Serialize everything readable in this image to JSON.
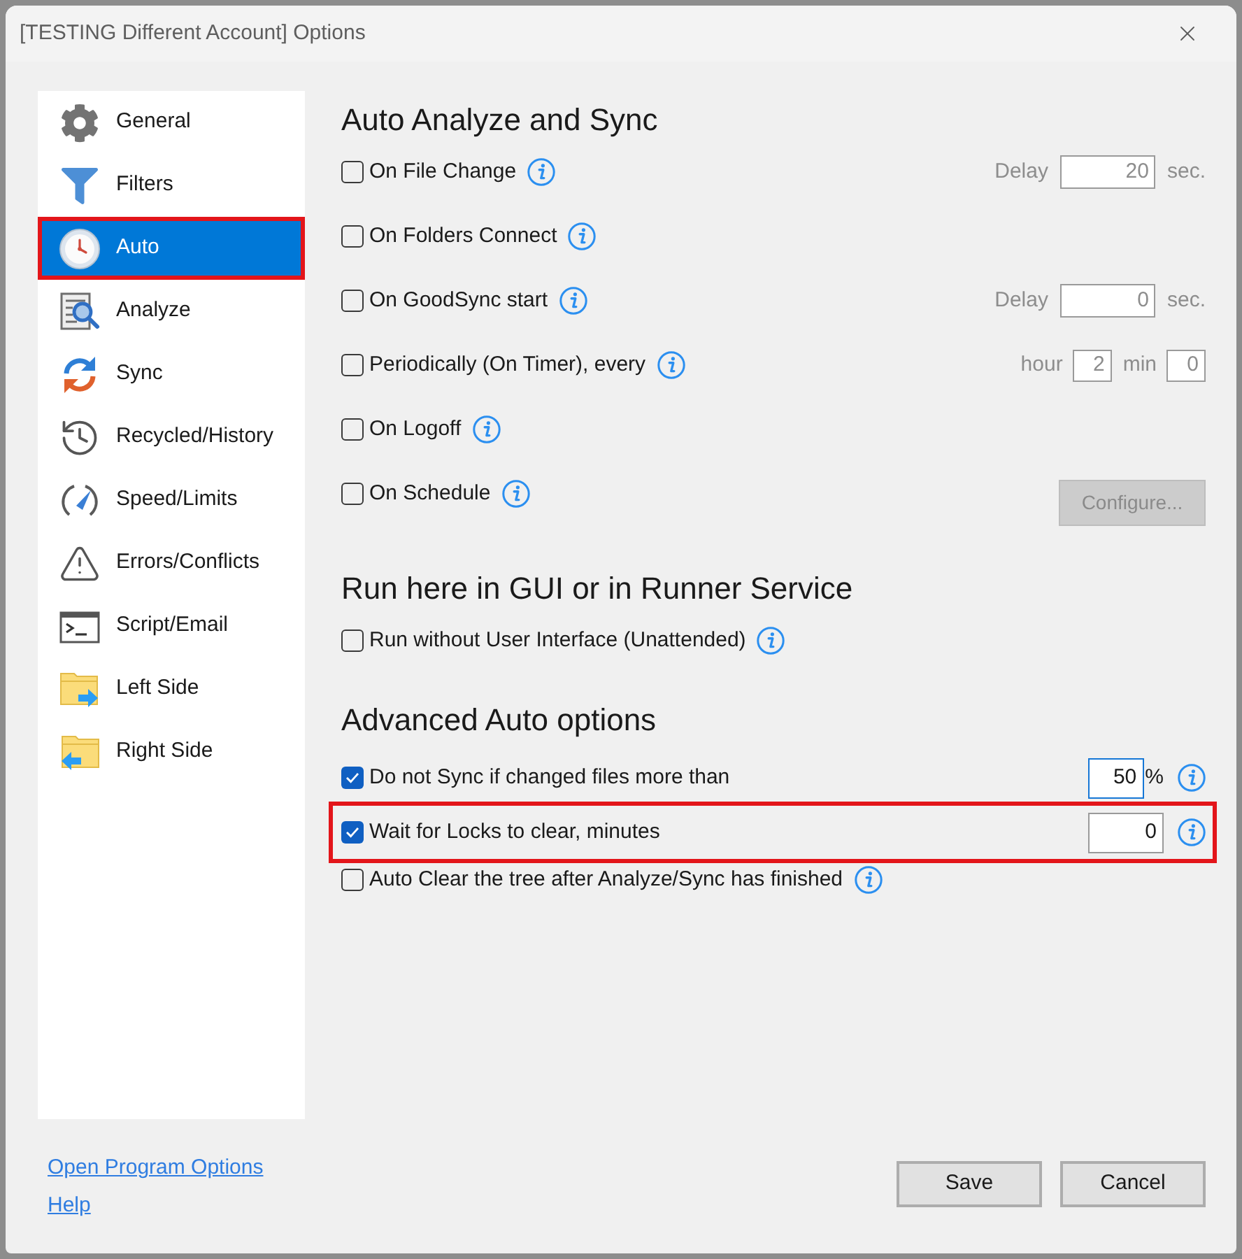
{
  "window": {
    "title": "[TESTING Different Account] Options"
  },
  "sidebar": {
    "items": [
      {
        "label": "General",
        "selected": false,
        "highlighted": false
      },
      {
        "label": "Filters",
        "selected": false,
        "highlighted": false
      },
      {
        "label": "Auto",
        "selected": true,
        "highlighted": true
      },
      {
        "label": "Analyze",
        "selected": false,
        "highlighted": false
      },
      {
        "label": "Sync",
        "selected": false,
        "highlighted": false
      },
      {
        "label": "Recycled/History",
        "selected": false,
        "highlighted": false
      },
      {
        "label": "Speed/Limits",
        "selected": false,
        "highlighted": false
      },
      {
        "label": "Errors/Conflicts",
        "selected": false,
        "highlighted": false
      },
      {
        "label": "Script/Email",
        "selected": false,
        "highlighted": false
      },
      {
        "label": "Left Side",
        "selected": false,
        "highlighted": false
      },
      {
        "label": "Right Side",
        "selected": false,
        "highlighted": false
      }
    ]
  },
  "sections": [
    {
      "heading": "Auto Analyze and Sync",
      "options": [
        {
          "kind": "delay",
          "label": "On File Change",
          "checked": false,
          "highlighted": false,
          "fields": [
            {
              "label": "Delay",
              "value": "20",
              "unit": "sec.",
              "focused": false
            }
          ]
        },
        {
          "kind": "plain",
          "label": "On Folders Connect",
          "checked": false,
          "highlighted": false
        },
        {
          "kind": "delay",
          "label": "On GoodSync start",
          "checked": false,
          "highlighted": false,
          "fields": [
            {
              "label": "Delay",
              "value": "0",
              "unit": "sec.",
              "focused": false
            }
          ]
        },
        {
          "kind": "timer",
          "label": "Periodically (On Timer), every",
          "checked": false,
          "highlighted": false,
          "fields": [
            {
              "label": "hour",
              "value": "2",
              "focused": false
            },
            {
              "label": "min",
              "value": "0",
              "focused": false
            }
          ]
        },
        {
          "kind": "plain",
          "label": "On Logoff",
          "checked": false,
          "highlighted": false
        },
        {
          "kind": "button",
          "label": "On Schedule",
          "checked": false,
          "highlighted": false,
          "button": {
            "label": "Configure...",
            "disabled": true
          }
        }
      ]
    },
    {
      "heading": "Run here in GUI or in Runner Service",
      "options": [
        {
          "kind": "plain",
          "label": "Run without User Interface (Unattended)",
          "checked": false,
          "highlighted": false
        }
      ]
    },
    {
      "heading": "Advanced Auto options",
      "options": [
        {
          "kind": "percent",
          "label": "Do not Sync if changed files more than",
          "checked": true,
          "highlighted": false,
          "fields": [
            {
              "value": "50",
              "unit": "%",
              "focused": true
            }
          ]
        },
        {
          "kind": "count",
          "label": "Wait for Locks to clear, minutes",
          "checked": true,
          "highlighted": true,
          "fields": [
            {
              "value": "0",
              "focused": false
            }
          ]
        },
        {
          "kind": "plain",
          "label": "Auto Clear the tree after Analyze/Sync has finished",
          "checked": false,
          "highlighted": false
        }
      ]
    }
  ],
  "links": [
    {
      "label": "Open Program Options"
    },
    {
      "label": "Help"
    }
  ],
  "buttons": [
    {
      "label": "Save"
    },
    {
      "label": "Cancel"
    }
  ]
}
